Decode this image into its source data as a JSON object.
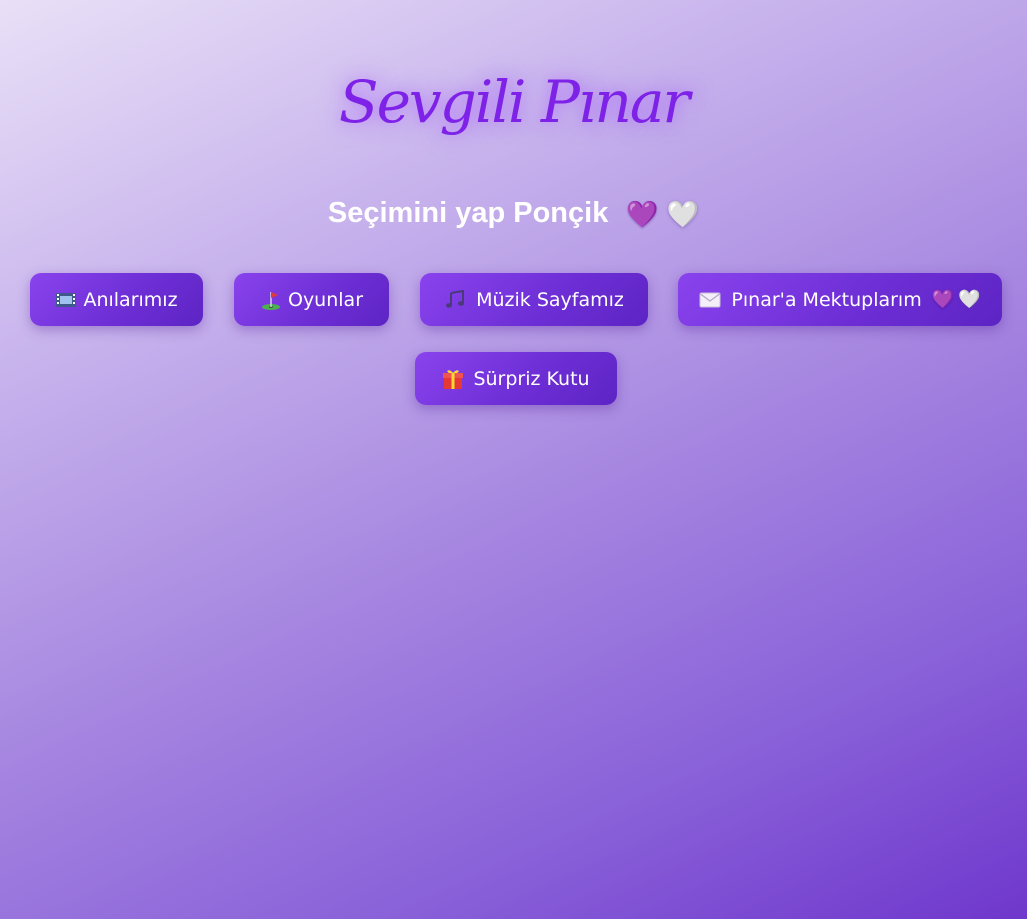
{
  "header": {
    "title": "Sevgili Pınar",
    "subtitle": "Seçimini yap Ponçik"
  },
  "menu": {
    "buttons": [
      {
        "label": "Anılarımız",
        "icon": "film-icon"
      },
      {
        "label": "Oyunlar",
        "icon": "golf-flag-icon"
      },
      {
        "label": "Müzik Sayfamız",
        "icon": "music-note-icon"
      },
      {
        "label": "Pınar'a Mektuplarım",
        "icon": "envelope-icon"
      },
      {
        "label": "Sürpriz Kutu",
        "icon": "gift-icon"
      }
    ]
  },
  "icons": {
    "heart_purple": "💜",
    "heart_white": "🤍"
  },
  "colors": {
    "accent": "#7d22e6",
    "button": "#6e2fd6",
    "background_top": "#e9e0f7",
    "background_bottom": "#6f37cc"
  }
}
